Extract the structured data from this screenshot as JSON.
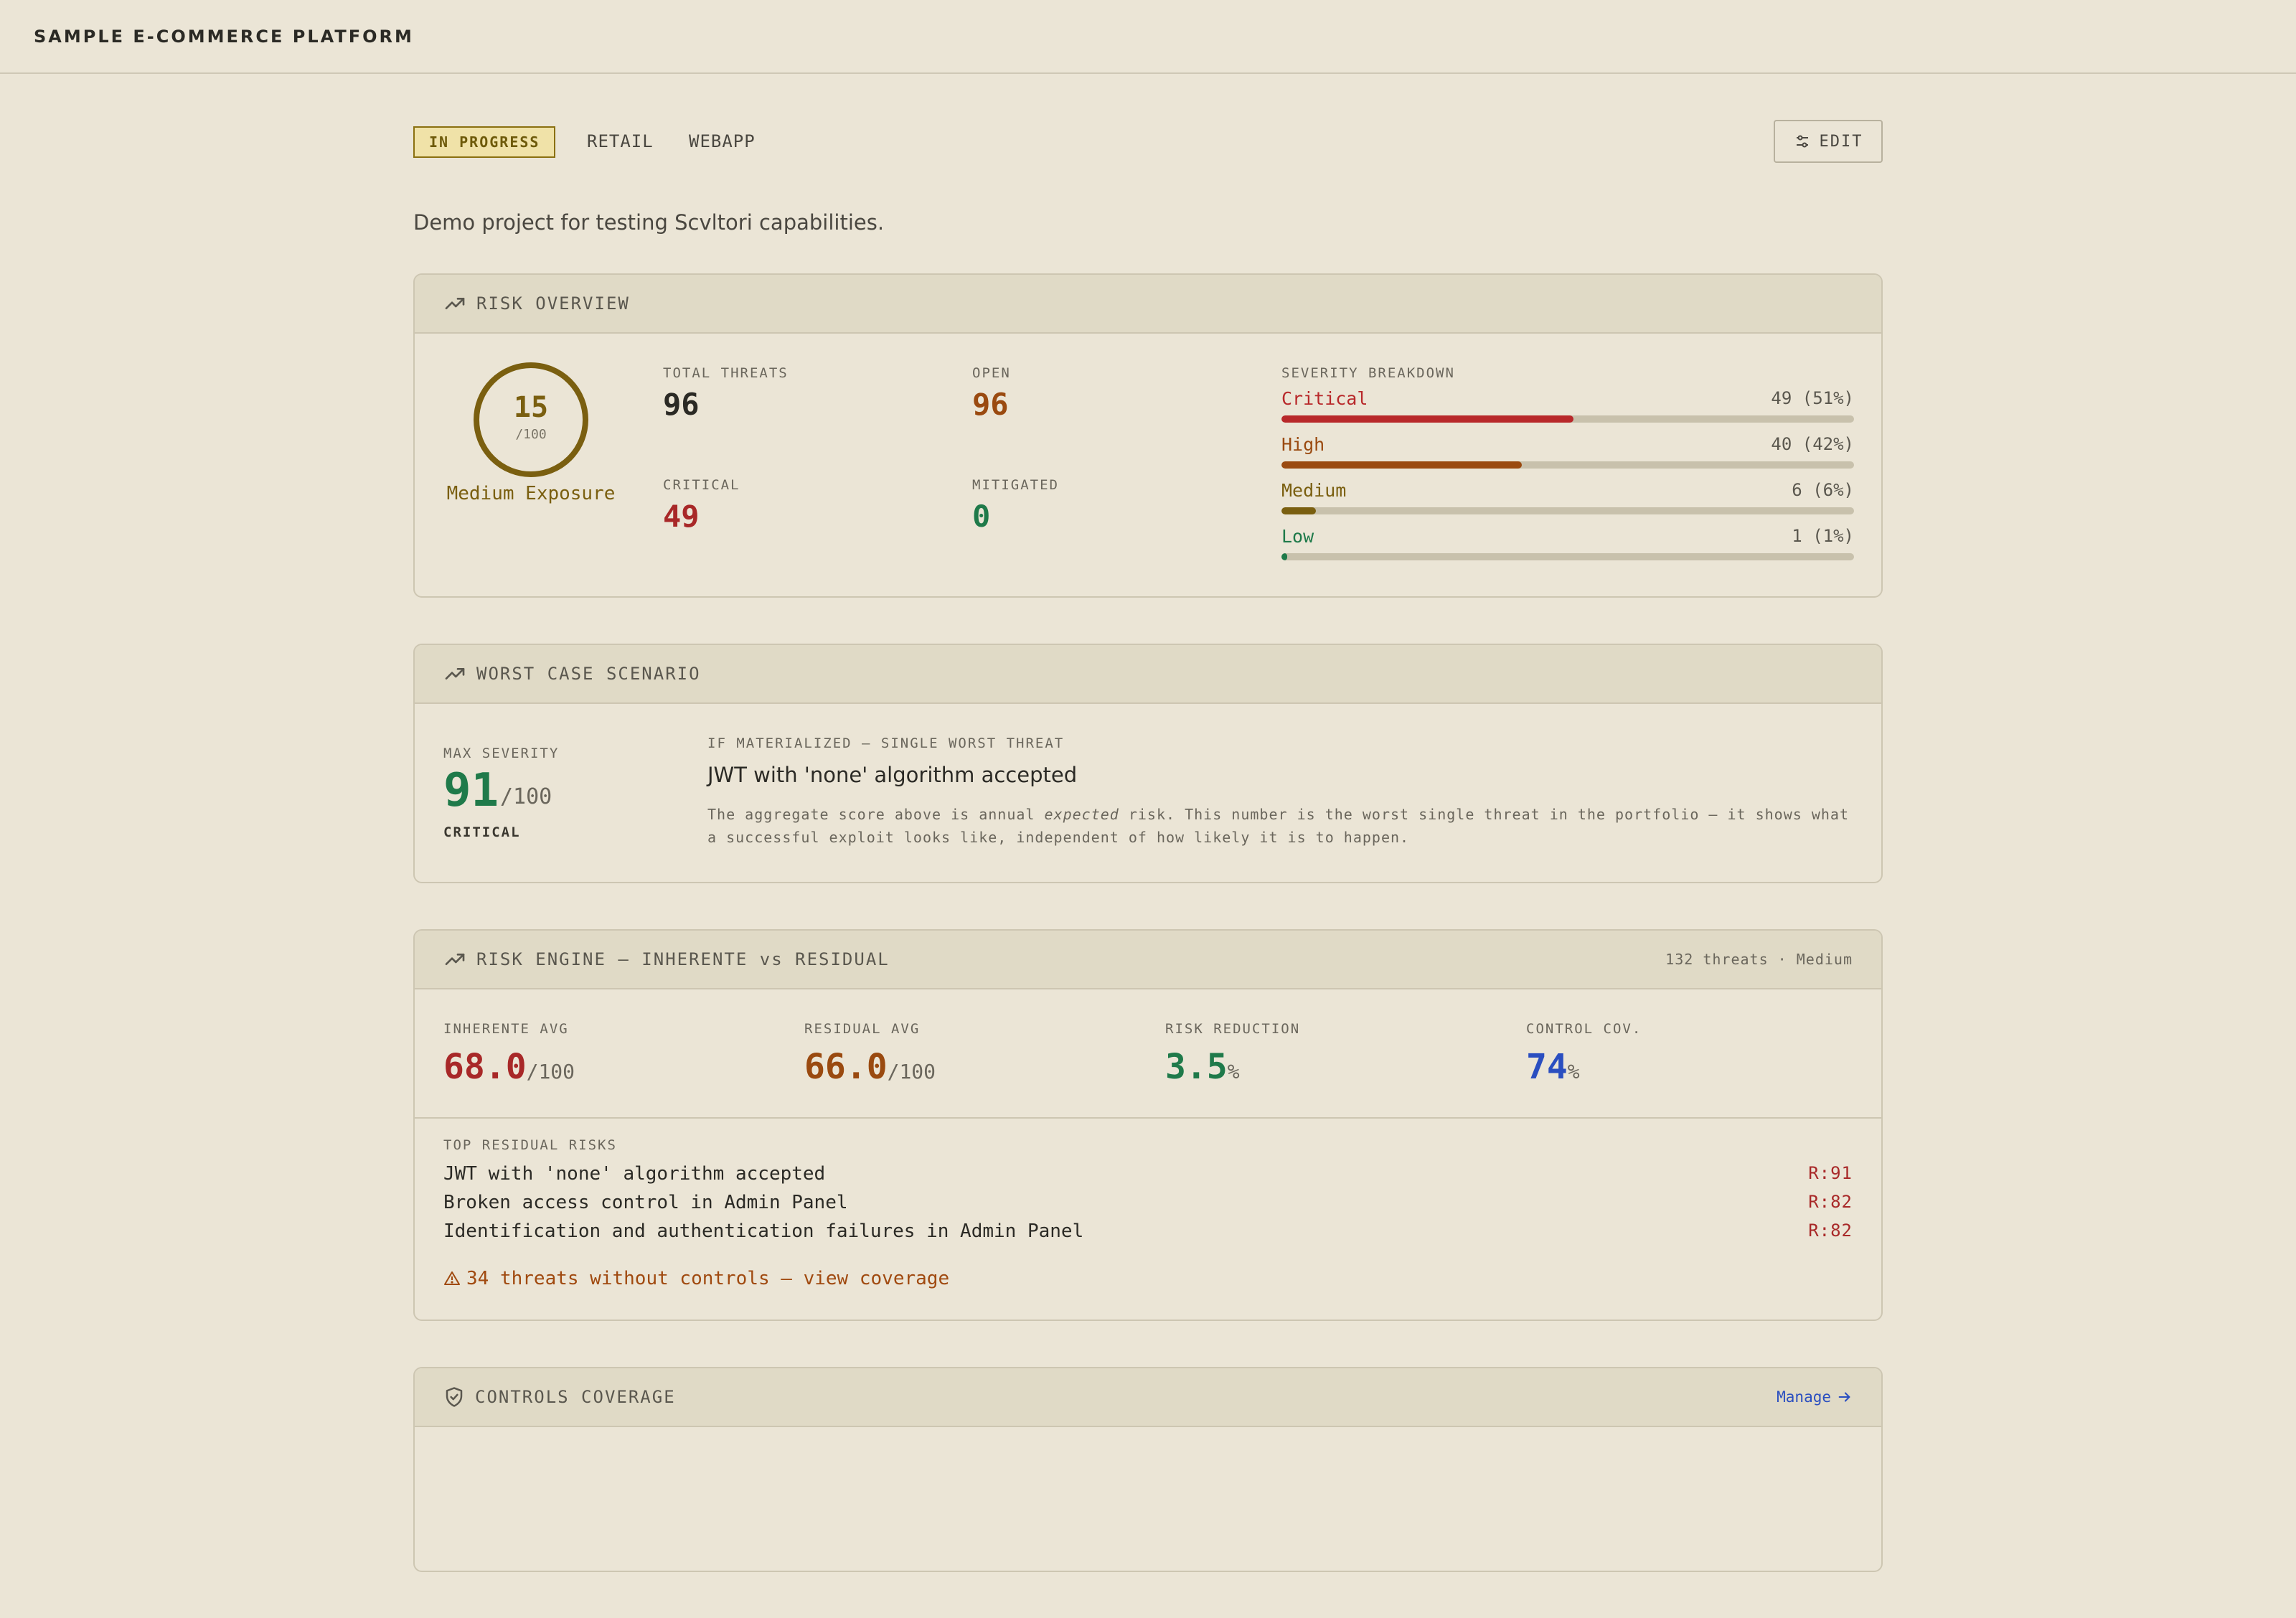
{
  "app": {
    "title": "SAMPLE E-COMMERCE PLATFORM"
  },
  "project": {
    "status": "IN PROGRESS",
    "tags": [
      "RETAIL",
      "WEBAPP"
    ],
    "edit_label": "EDIT",
    "description": "Demo project for testing Scvltori capabilities."
  },
  "risk_overview": {
    "title": "RISK OVERVIEW",
    "exposure_score": "15",
    "exposure_max": "/100",
    "exposure_fraction": 0.15,
    "exposure_label": "Medium Exposure",
    "total_threats_label": "TOTAL THREATS",
    "total_threats": "96",
    "open_label": "OPEN",
    "open": "96",
    "critical_label": "CRITICAL",
    "critical": "49",
    "mitigated_label": "MITIGATED",
    "mitigated": "0",
    "severity_title": "SEVERITY BREAKDOWN",
    "severity": [
      {
        "name": "Critical",
        "count": "49 (51%)",
        "fraction": 0.51,
        "color": "#b8282a"
      },
      {
        "name": "High",
        "count": "40 (42%)",
        "fraction": 0.42,
        "color": "#9a4a10"
      },
      {
        "name": "Medium",
        "count": "6 (6%)",
        "fraction": 0.06,
        "color": "#7a5f10"
      },
      {
        "name": "Low",
        "count": "1 (1%)",
        "fraction": 0.01,
        "color": "#1f7a4a"
      }
    ]
  },
  "worst_case": {
    "title": "WORST CASE SCENARIO",
    "max_severity_label": "MAX SEVERITY",
    "score": "91",
    "score_max": "/100",
    "level": "CRITICAL",
    "scenario_label": "IF MATERIALIZED — SINGLE WORST THREAT",
    "threat": "JWT with 'none' algorithm accepted",
    "note_before": "The aggregate score above is annual ",
    "note_em": "expected",
    "note_after": " risk. This number is the worst single threat in the portfolio — it shows what a successful exploit looks like, independent of how likely it is to happen."
  },
  "risk_engine": {
    "title": "RISK ENGINE — INHERENTE vs RESIDUAL",
    "meta": "132 threats · Medium",
    "metrics": [
      {
        "label": "INHERENTE AVG",
        "value": "68.0",
        "suffix": "/100",
        "color": "#a82828"
      },
      {
        "label": "RESIDUAL AVG",
        "value": "66.0",
        "suffix": "/100",
        "color": "#9a4a10"
      },
      {
        "label": "RISK REDUCTION",
        "value": "3.5",
        "suffix": "%",
        "color": "#1f7a4a"
      },
      {
        "label": "CONTROL COV.",
        "value": "74",
        "suffix": "%",
        "color": "#2a4ec0"
      }
    ],
    "top_title": "TOP RESIDUAL RISKS",
    "top_risks": [
      {
        "name": "JWT with 'none' algorithm accepted",
        "score": "R:91"
      },
      {
        "name": "Broken access control in Admin Panel",
        "score": "R:82"
      },
      {
        "name": "Identification and authentication failures in Admin Panel",
        "score": "R:82"
      }
    ],
    "coverage_link": "34 threats without controls — view coverage"
  },
  "controls": {
    "title": "CONTROLS COVERAGE",
    "manage_label": "Manage"
  }
}
